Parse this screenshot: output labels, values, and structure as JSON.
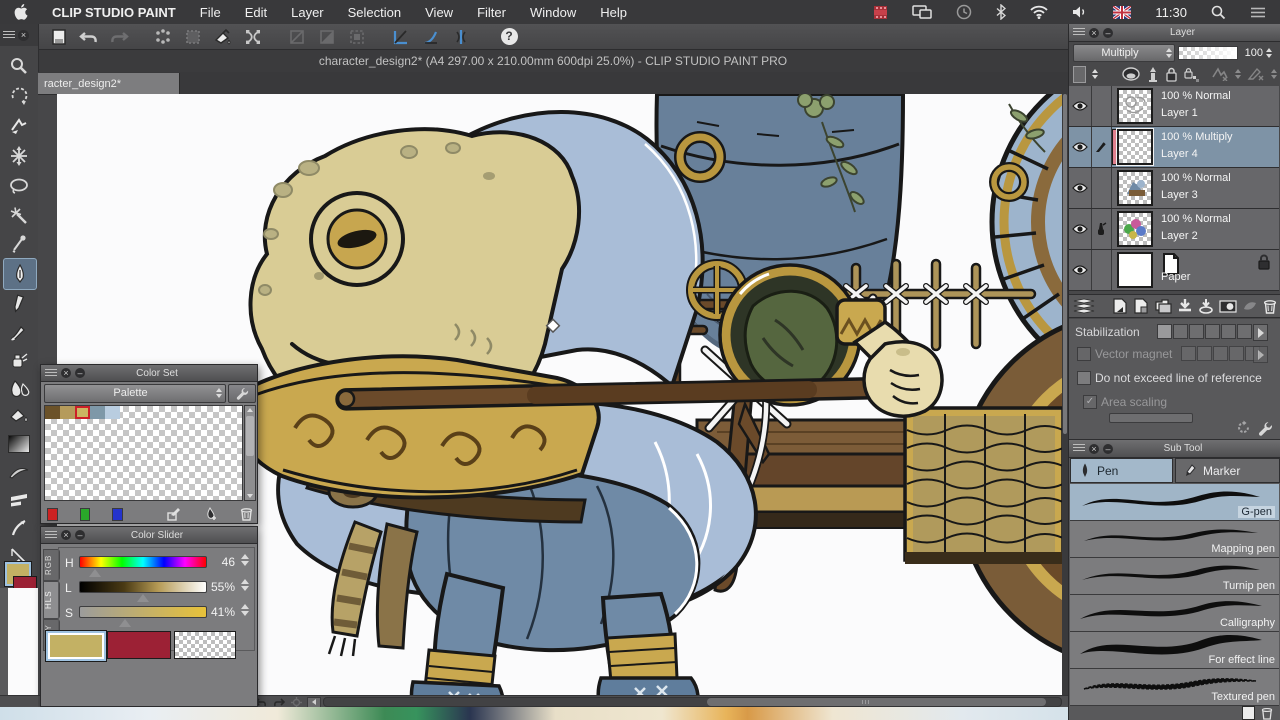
{
  "menu_bar": {
    "app_name": "CLIP STUDIO PAINT",
    "items": [
      "File",
      "Edit",
      "Layer",
      "Selection",
      "View",
      "Filter",
      "Window",
      "Help"
    ],
    "time": "11:30"
  },
  "toolbar": {
    "help_label": "?"
  },
  "document": {
    "window_title": "character_design2* (A4 297.00 x 210.00mm 600dpi 25.0%)  - CLIP STUDIO PAINT PRO",
    "tab_label": "racter_design2*"
  },
  "tool_colors": {
    "foreground": "#c3b164",
    "background": "#9c2135"
  },
  "color_set": {
    "title": "Color Set",
    "dropdown": "Palette",
    "swatches": [
      "#6b5229",
      "#b59b5b",
      "#cbb662",
      "#7e98a8",
      "#b9cde0"
    ],
    "quick_swatches": [
      "#cc2222",
      "#2aa82a",
      "#2433cc"
    ]
  },
  "color_slider": {
    "title": "Color Slider",
    "tabs": [
      "RGB",
      "HLS",
      "CMY"
    ],
    "sliders": [
      {
        "label": "H",
        "value": "46"
      },
      {
        "label": "L",
        "value": "55%"
      },
      {
        "label": "S",
        "value": "41%"
      }
    ]
  },
  "layer_panel": {
    "title": "Layer",
    "blend_mode": "Multiply",
    "opacity": "100",
    "layers": [
      {
        "info": "100 % Normal",
        "name": "Layer 1"
      },
      {
        "info": "100 % Multiply",
        "name": "Layer 4"
      },
      {
        "info": "100 % Normal",
        "name": "Layer 3"
      },
      {
        "info": "100 % Normal",
        "name": "Layer 2"
      },
      {
        "info": "",
        "name": "Paper"
      }
    ]
  },
  "tool_property": {
    "stabilization_label": "Stabilization",
    "vector_magnet_label": "Vector magnet",
    "no_exceed_label": "Do not exceed line of reference",
    "area_scaling_label": "Area scaling"
  },
  "sub_tool": {
    "title": "Sub Tool",
    "tabs": [
      {
        "label": "Pen"
      },
      {
        "label": "Marker"
      }
    ],
    "brushes": [
      {
        "name": "G-pen"
      },
      {
        "name": "Mapping pen"
      },
      {
        "name": "Turnip pen"
      },
      {
        "name": "Calligraphy"
      },
      {
        "name": "For effect line"
      },
      {
        "name": "Textured pen"
      }
    ]
  }
}
